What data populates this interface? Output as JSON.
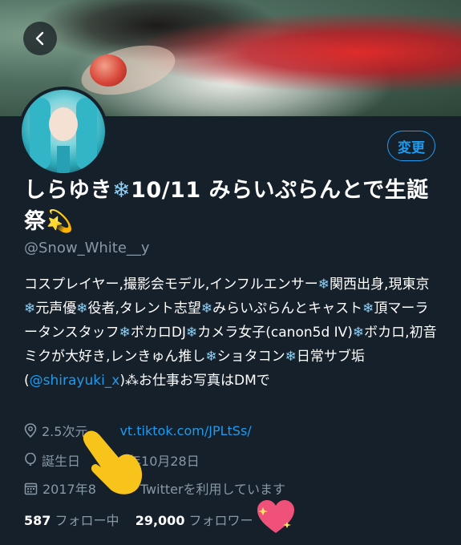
{
  "banner": {
    "description_icon": "banner-photo"
  },
  "nav": {
    "back_icon": "chevron-left-icon"
  },
  "profile": {
    "edit_label": "変更",
    "name_part1": "しらゆき",
    "name_snow": "❄",
    "name_part2": "10/11 みらいぷらんとで生誕祭",
    "name_sparkle": "💫",
    "handle": "@Snow_White__y"
  },
  "bio": {
    "seg1": "コスプレイヤー,撮影会モデル,インフルエンサー",
    "seg2": "関西出身,現東京",
    "seg3": "元声優",
    "seg4": "役者,タレント志望",
    "seg5": "みらいぷらんとキャスト",
    "seg6": "頂マーラータンスタッフ",
    "seg7": "ボカロDJ",
    "seg8": "カメラ女子(canon5d IV)",
    "seg9": "ボカロ,初音ミクが大好き,レンきゅん推し",
    "seg10": "ショタコン",
    "seg11": "日常サブ垢(",
    "link": "@shirayuki_x",
    "seg12": ")",
    "star": "⁂",
    "seg13": "お仕事お写真はDMで",
    "snow": "❄"
  },
  "meta": {
    "location": "2.5次元",
    "website": "vt.tiktok.com/JPLtSs/",
    "birthday_prefix": "誕生日",
    "birthday_suffix": "年10月28日",
    "joined_prefix": "2017年8",
    "joined_suffix": "Twitterを利用しています"
  },
  "stats": {
    "following_count": "587",
    "following_label": "フォロー中",
    "followers_count": "29,000",
    "followers_label": "フォロワー"
  },
  "colors": {
    "background": "#15202b",
    "accent": "#1d9bf0",
    "secondary_text": "#8899a6"
  }
}
